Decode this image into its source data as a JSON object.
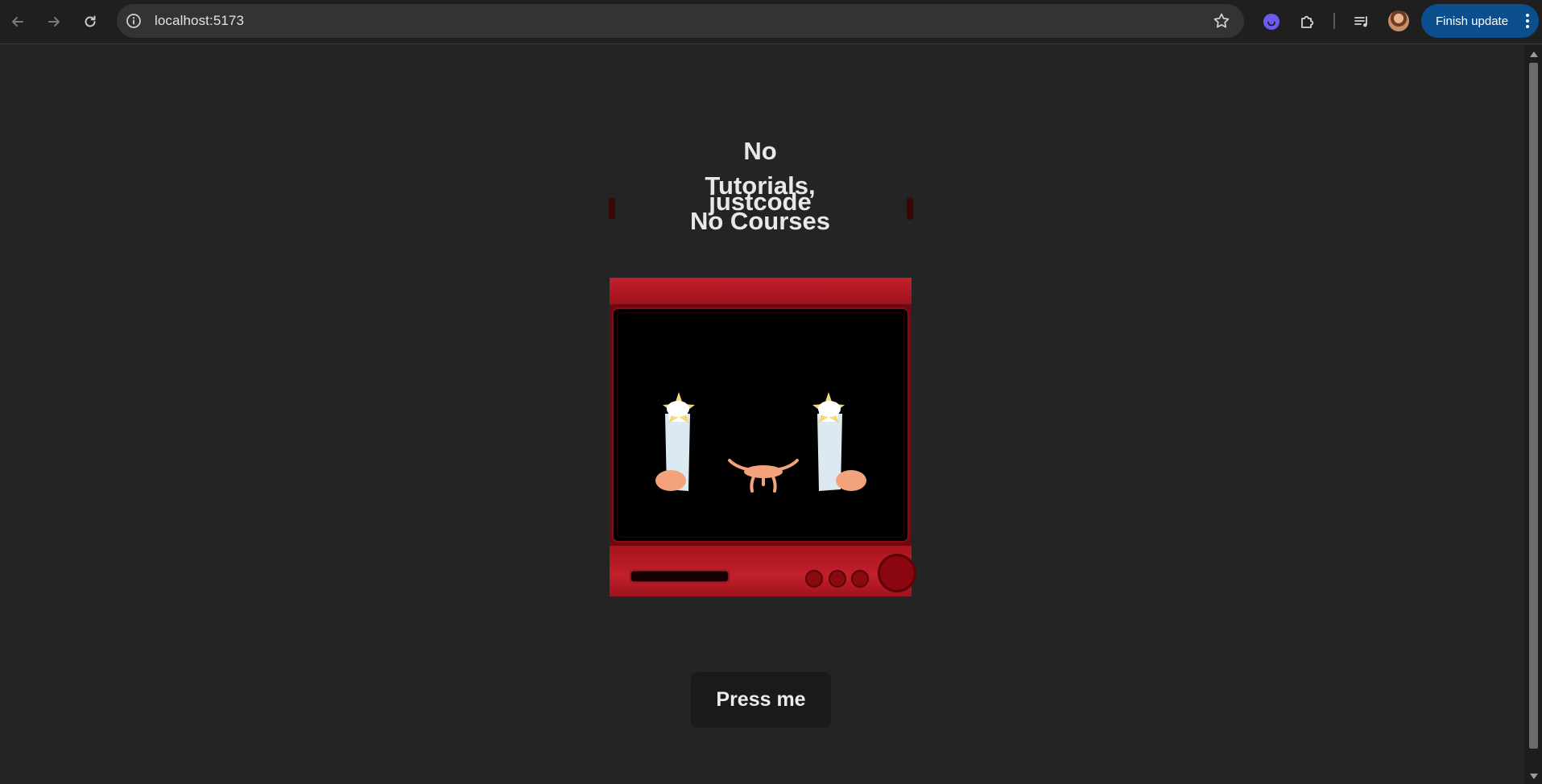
{
  "browser": {
    "url": "localhost:5173",
    "update_button_label": "Finish update"
  },
  "page": {
    "slogan_lines": [
      "No",
      "Tutorials,",
      "justcode",
      "No Courses"
    ],
    "button_label": "Press me"
  },
  "colors": {
    "page_background": "#242424",
    "tv_red": "#c4202c",
    "button_background": "#1a1a1a",
    "update_button": "#0b4f8e"
  }
}
